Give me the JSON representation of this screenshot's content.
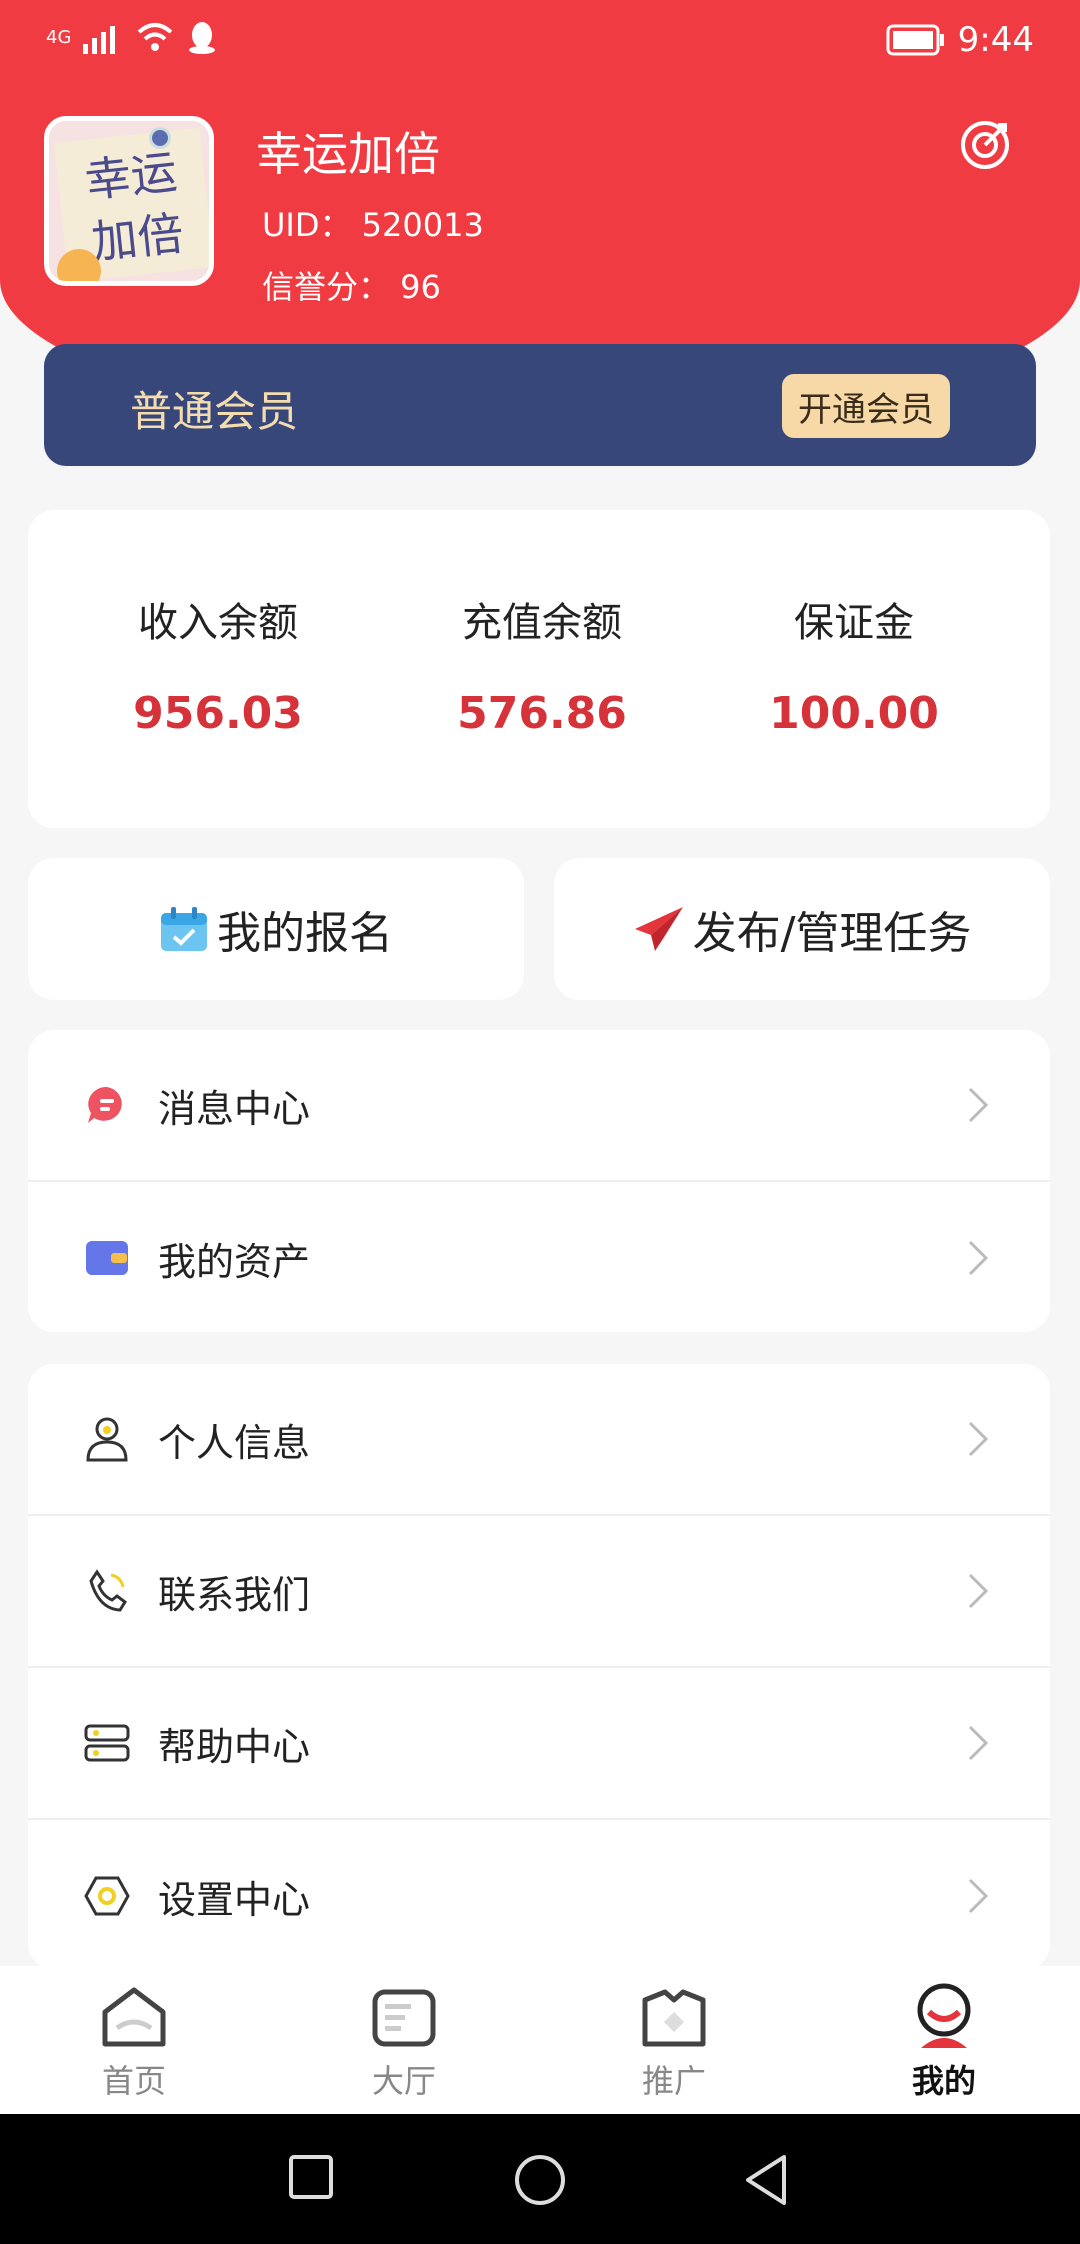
{
  "status": {
    "network": "4G",
    "time": "9:44"
  },
  "profile": {
    "avatar_text": "幸运加倍",
    "name": "幸运加倍",
    "uid": "UID：  520013",
    "credit": "信誉分：  96"
  },
  "vip": {
    "level": "普通会员",
    "button": "开通会员"
  },
  "balances": [
    {
      "title": "收入余额",
      "value": "956.03"
    },
    {
      "title": "充值余额",
      "value": "576.86"
    },
    {
      "title": "保证金",
      "value": "100.00"
    }
  ],
  "actions": {
    "my_signup": "我的报名",
    "publish": "发布/管理任务"
  },
  "menu1": [
    {
      "label": "消息中心",
      "icon": "message-icon"
    },
    {
      "label": "我的资产",
      "icon": "wallet-icon"
    }
  ],
  "menu2": [
    {
      "label": "个人信息",
      "icon": "user-icon"
    },
    {
      "label": "联系我们",
      "icon": "phone-icon"
    },
    {
      "label": "帮助中心",
      "icon": "help-icon"
    },
    {
      "label": "设置中心",
      "icon": "settings-icon"
    }
  ],
  "tabs": [
    {
      "label": "首页",
      "icon": "home-icon"
    },
    {
      "label": "大厅",
      "icon": "hall-icon"
    },
    {
      "label": "推广",
      "icon": "promote-icon"
    },
    {
      "label": "我的",
      "icon": "profile-icon",
      "active": true
    }
  ],
  "colors": {
    "header": "#ef3b41",
    "vip_bar": "#384779",
    "accent": "#d5323a"
  }
}
